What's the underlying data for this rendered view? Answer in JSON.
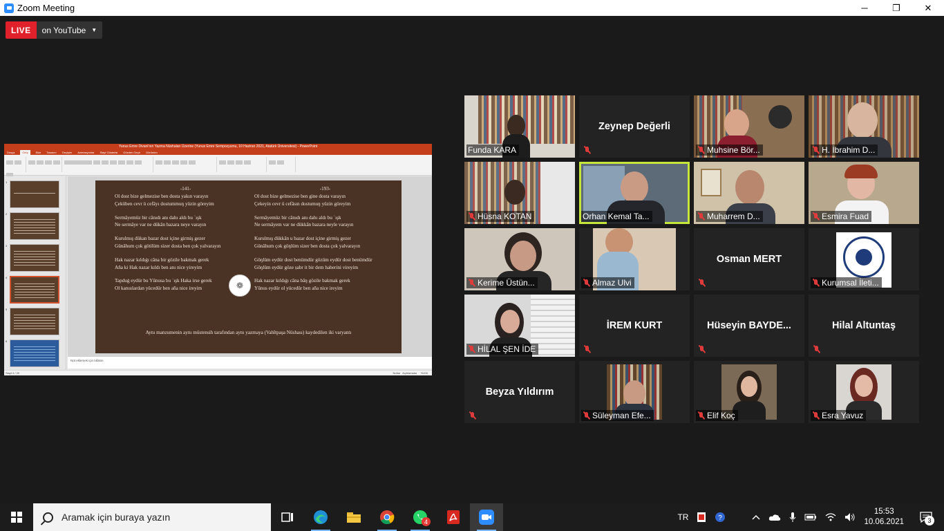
{
  "window": {
    "title": "Zoom Meeting",
    "controls": [
      "─",
      "❐",
      "✕"
    ]
  },
  "live": {
    "badge": "LIVE",
    "destination": "on YouTube",
    "caret": "▼"
  },
  "shared_screen": {
    "app_title": "Yunus Emre Divani'nın Yazma Nüshaları Üzerine (Yunus Emre Sempozyumu, 10 Haziran 2021, Atatürk Üniversitesi) - PowerPoint",
    "ribbon_tabs": [
      "Dosya",
      "Giriş",
      "Ekle",
      "Tasarım",
      "Geçişler",
      "Animasyonlar",
      "Slayt Gösterisi",
      "Gözden Geçir",
      "Görünüm"
    ],
    "slide": {
      "left_number": "-141-",
      "right_number": "-193-",
      "left_stanzas": [
        [
          "Ol dost bize gelmezise ben dosta yakın varayın",
          "Çeküben cevr ü cefāyı dostummuŋ yüzin göreyim"
        ],
        [
          "Sermāyemüz bir cānıdı anı dahı aldı bu ʿışk",
          "Ne sermāye var ne dükān bazara neye varayın"
        ],
        [
          "Kurulmış dükan bazar dost içine girmiş gezer",
          "Günāhum çok götilüm sizer dosta ben çok yalvarayın"
        ],
        [
          "Hak nazar kıldıġı cāna bir gözile bakmak gerek",
          "Aña ki Hak nazar kıldı ben anı nice yireyim"
        ],
        [
          "Tapduġ eydür bu Yūnusa bu ʿışk Haka irse gerek",
          "Ol kanuılardan yücedür ben aña nice ireyim"
        ]
      ],
      "right_stanzas": [
        [
          "Ol dost bize gelmezise ben gine dosta varayın",
          "Çekeyin cevr ü cefāsın dostumuŋ yüzin göreyim"
        ],
        [
          "Sermāyemüz bir cānıdı anı dahı aldı bu ʿışk",
          "Ne sermāyem var ne dükkān bazara neyle varayın"
        ],
        [
          "Kurulmış dükkān u bazar dost içine girmiş gezer",
          "Günāhum çok göŋlüm sizer ben dosta çok yalvarayın"
        ],
        [
          "Göŋlüm eydür dost benümdür gözüm eydür dost benümdür",
          "Göŋlüm eydür göze ṣabr it bir dem haberini vireyim"
        ],
        [
          "Hak nazar kıldıġı cāna bāŋ gözile bakmak gerek",
          "Yūnus eydür ol yücedür ben aña nice ireyim"
        ]
      ],
      "caption": "Aynı manzumenin aynı müstensih tarafından aynı yazmaya (Vahîtpaşa Nüshası) kaydedilen iki varyantı"
    },
    "notes_placeholder": "Not eklemek için tıklatın",
    "status_left": "Slayt 4 / 20",
    "status_notes": "Notlar",
    "status_comments": "Açıklamalar",
    "zoom_level": "%100"
  },
  "participants": [
    {
      "name": "Funda KARA",
      "video": true,
      "muted": false
    },
    {
      "name": "Zeynep Değerli",
      "video": false,
      "muted": true
    },
    {
      "name": "Muhsine Bör...",
      "video": true,
      "muted": true
    },
    {
      "name": "H. İbrahim D...",
      "video": true,
      "muted": true
    },
    {
      "name": "Hüsna KOTAN",
      "video": true,
      "muted": true
    },
    {
      "name": "Orhan Kemal Ta...",
      "video": true,
      "muted": false,
      "speaking": true
    },
    {
      "name": "Muharrem D...",
      "video": true,
      "muted": true
    },
    {
      "name": "Esmira Fuad",
      "video": true,
      "muted": true
    },
    {
      "name": "Kerime Üstün...",
      "video": true,
      "muted": true
    },
    {
      "name": "Almaz Ulvi",
      "video": true,
      "muted": true
    },
    {
      "name": "Osman MERT",
      "video": false,
      "muted": true
    },
    {
      "name": "Kurumsal İleti...",
      "video": true,
      "muted": true
    },
    {
      "name": "HİLAL ŞEN İDE",
      "video": true,
      "muted": true
    },
    {
      "name": "İREM KURT",
      "video": false,
      "muted": true
    },
    {
      "name": "Hüseyin  BAYDE...",
      "video": false,
      "muted": true
    },
    {
      "name": "Hilal Altuntaş",
      "video": false,
      "muted": true
    },
    {
      "name": "Beyza Yıldırım",
      "video": false,
      "muted": true
    },
    {
      "name": "Süleyman Efe...",
      "video": true,
      "muted": true
    },
    {
      "name": "Elif Koç",
      "video": true,
      "muted": true
    },
    {
      "name": "Esra Yavuz",
      "video": true,
      "muted": true
    }
  ],
  "taskbar": {
    "search_placeholder": "Aramak için buraya yazın",
    "apps": [
      "task-view-icon",
      "edge-icon",
      "file-explorer-icon",
      "chrome-icon",
      "whatsapp-icon",
      "acrobat-icon",
      "zoom-icon"
    ],
    "whatsapp_badge": "4",
    "language": "TR",
    "time": "15:53",
    "date": "10.06.2021",
    "notifications": "3"
  },
  "colors": {
    "live_red": "#e0202a",
    "powerpoint_accent": "#c43e1c",
    "speaker_outline": "#c7e63c",
    "mute_red": "#e03b3b",
    "slide_background": "#4a3224"
  }
}
